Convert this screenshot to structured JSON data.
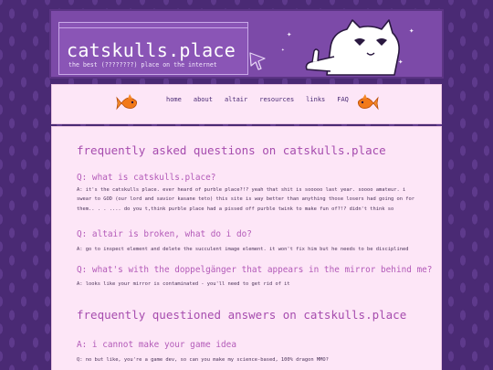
{
  "header": {
    "title": "catskulls.place",
    "subtitle": "the best (????????) place on the internet"
  },
  "nav": {
    "links": [
      "home",
      "about",
      "altair",
      "resources",
      "links",
      "FAQ"
    ]
  },
  "faq": {
    "heading": "frequently asked questions on catskulls.place",
    "items": [
      {
        "q": "Q: what is catskulls.place?",
        "a": "A: it's the catskulls place. ever heard of purble place?!? yeah that shit is sooooo last year. soooo amateur. i swear to GOD (our lord and savior kasane teto) this site is way better than anything those losers had going on for them.. . . .... do you t,think purble place had a pissed off purble twink to make fun of?!? didn't think so"
      },
      {
        "q": "Q: altair is broken, what do i do?",
        "a": "A: go to inspect element and delete the succulent image element. it won't fix him but he needs to be disciplined"
      },
      {
        "q": "Q: what's with the doppelgänger that appears in the mirror behind me?",
        "a": "A: looks like your mirror is contaminated - you'll need to get rid of it"
      }
    ]
  },
  "fqa": {
    "heading": "frequently questioned answers on catskulls.place",
    "items": [
      {
        "q": "A: i cannot make your game idea",
        "a": "Q: no but like, you're a game dev, so can you make my science-based, 100% dragon MMO?"
      }
    ]
  },
  "colors": {
    "background": "#4a2a74",
    "header": "#7c4aa8",
    "panel": "#fde6f7",
    "heading": "#a64cae"
  }
}
